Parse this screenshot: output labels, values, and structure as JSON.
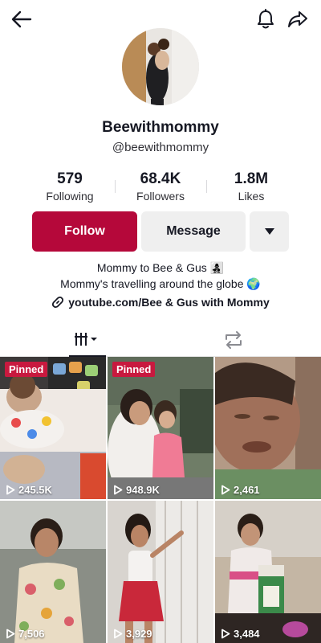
{
  "topbar": {
    "back_icon": "arrow-left-icon",
    "notify_icon": "bell-icon",
    "share_icon": "share-arrow-icon"
  },
  "profile": {
    "display_name": "Beewithmommy",
    "handle": "@beewithmommy"
  },
  "stats": [
    {
      "value": "579",
      "label": "Following"
    },
    {
      "value": "68.4K",
      "label": "Followers"
    },
    {
      "value": "1.8M",
      "label": "Likes"
    }
  ],
  "actions": {
    "follow_label": "Follow",
    "message_label": "Message",
    "follow_color": "#b5083a"
  },
  "bio": {
    "line1": "Mommy to Bee & Gus 👩‍👧‍👦",
    "line2": "Mommy's travelling around the globe 🌍",
    "link": "youtube.com/Bee & Gus with Mommy"
  },
  "tabs": {
    "videos_icon": "grid-lines-icon",
    "reposts_icon": "repost-icon"
  },
  "videos": [
    {
      "views": "245.5K",
      "pinned_label": "Pinned",
      "caption": ""
    },
    {
      "views": "948.9K",
      "pinned_label": "Pinned",
      "caption": ""
    },
    {
      "views": "2,461",
      "pinned_label": "",
      "caption": ""
    },
    {
      "views": "7,506",
      "pinned_label": "",
      "caption": ""
    },
    {
      "views": "3,929",
      "pinned_label": "",
      "caption": ""
    },
    {
      "views": "3,484",
      "pinned_label": "",
      "caption": ""
    }
  ]
}
